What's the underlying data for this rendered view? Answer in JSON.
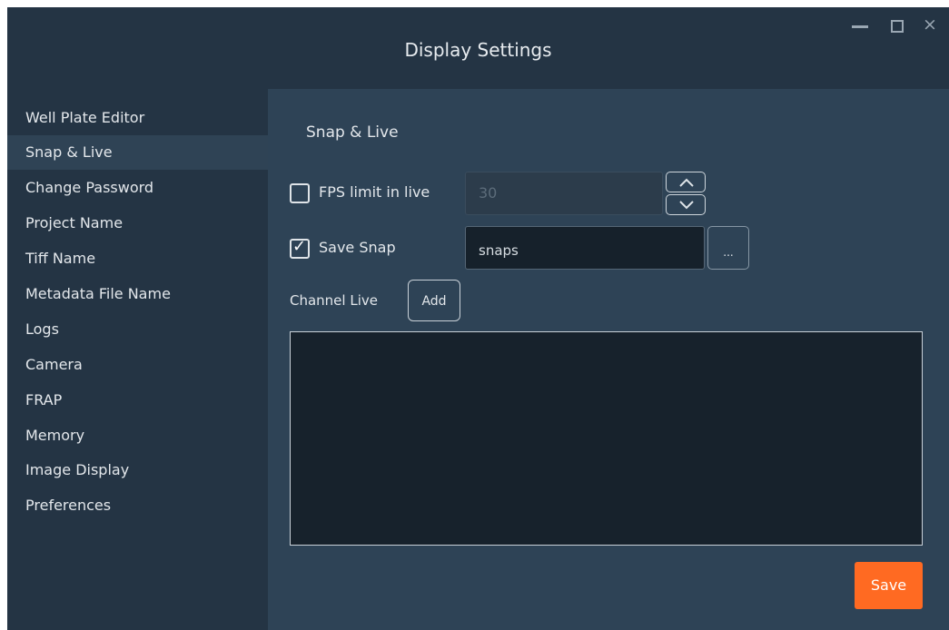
{
  "window": {
    "title": "Display Settings",
    "controls": {
      "minimize": "minimize-icon",
      "maximize": "maximize-icon",
      "close": "×"
    }
  },
  "sidebar": {
    "items": [
      {
        "label": "Well Plate Editor"
      },
      {
        "label": "Snap & Live",
        "selected": true
      },
      {
        "label": "Change Password"
      },
      {
        "label": "Project Name"
      },
      {
        "label": "Tiff Name"
      },
      {
        "label": "Metadata File Name"
      },
      {
        "label": "Logs"
      },
      {
        "label": "Camera"
      },
      {
        "label": "FRAP"
      },
      {
        "label": "Memory"
      },
      {
        "label": "Image Display"
      },
      {
        "label": "Preferences"
      }
    ]
  },
  "panel": {
    "title": "Snap & Live",
    "fps": {
      "label": "FPS limit in live",
      "checked": false,
      "value": "30"
    },
    "save_snap": {
      "label": "Save Snap",
      "checked": true,
      "value": "snaps",
      "browse_label": "..."
    },
    "channel": {
      "label": "Channel Live",
      "add_label": "Add"
    },
    "save_label": "Save"
  },
  "colors": {
    "accent": "#ff6a22",
    "background": "#243444",
    "panel": "#2e4356"
  }
}
